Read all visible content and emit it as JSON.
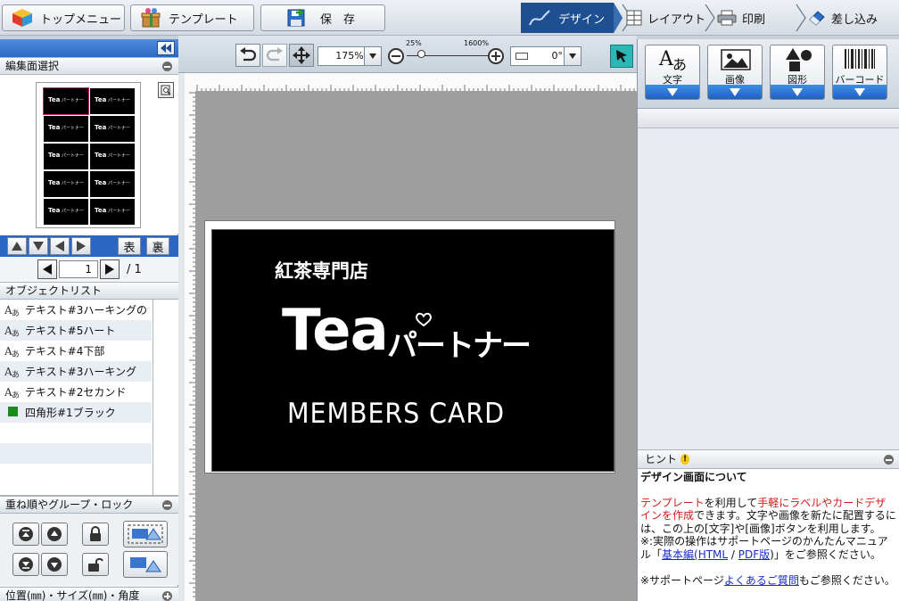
{
  "toolbar": {
    "top_menu": "トップメニュー",
    "template": "テンプレート",
    "save": "保　存"
  },
  "nav_tabs": [
    {
      "label": "デザイン",
      "icon": "pen-curve-icon",
      "active": true
    },
    {
      "label": "レイアウト",
      "icon": "grid-layout-icon",
      "active": false
    },
    {
      "label": "印刷",
      "icon": "printer-icon",
      "active": false
    },
    {
      "label": "差し込み",
      "icon": "eraser-icon",
      "active": false
    }
  ],
  "edit_tools": {
    "zoom_value": "175%",
    "zoom_min_label": "25%",
    "zoom_max_label": "1600%",
    "rotation_value": "0°"
  },
  "left_panel": {
    "edit_select_title": "編集面選択",
    "front_label": "表",
    "back_label": "裏",
    "page_value": "1",
    "page_total": "/ 1",
    "object_list_title": "オブジェクトリスト",
    "objects": [
      {
        "icon": "text-icon",
        "name": "テキスト#3ハーキングの"
      },
      {
        "icon": "text-icon",
        "name": "テキスト#5ハート"
      },
      {
        "icon": "text-icon",
        "name": "テキスト#4下部"
      },
      {
        "icon": "text-icon",
        "name": "テキスト#3ハーキング"
      },
      {
        "icon": "text-icon",
        "name": "テキスト#2セカンド"
      },
      {
        "icon": "green-square-icon",
        "name": "四角形#1ブラック"
      }
    ],
    "order_group_title": "重ね順やグループ・ロック",
    "position_title": "位置(㎜)・サイズ(㎜)・角度"
  },
  "card": {
    "shop_name": "紅茶専門店",
    "title_main": "Tea",
    "title_sub": "パートナー",
    "members": "MEMBERS CARD"
  },
  "thumbnail": {
    "cell_title": "Tea",
    "cell_sub": "パートナー"
  },
  "right_panel": {
    "insert_buttons": [
      {
        "label": "文字",
        "icon": "text-insert-icon"
      },
      {
        "label": "画像",
        "icon": "image-insert-icon"
      },
      {
        "label": "図形",
        "icon": "shape-insert-icon"
      },
      {
        "label": "バーコード",
        "icon": "barcode-icon"
      }
    ],
    "hint": {
      "title": "ヒント",
      "heading": "デザイン画面について",
      "p1_a": "テンプレート",
      "p1_b": "を利用して",
      "p1_c": "手軽にラベルやカードデザインを作成",
      "p1_d": "できます。文字や画像を新たに配置するには、この上の[文字]や[画像]ボタンを利用します。",
      "p2_a": "※:実際の操作はサポートページのかんたんマニュアル「",
      "p2_link1": "基本編(HTML",
      "p2_sep": " / ",
      "p2_link2": "PDF版",
      "p2_b": ")」をご参照ください。",
      "p3_a": "※サポートページ",
      "p3_link": "よくあるご質問",
      "p3_b": "もご参照ください。"
    }
  },
  "colors": {
    "accent_blue": "#2b6fd0",
    "nav_active": "#1d4f91",
    "hint_red": "#d21a1a",
    "card_bg": "#000000"
  }
}
